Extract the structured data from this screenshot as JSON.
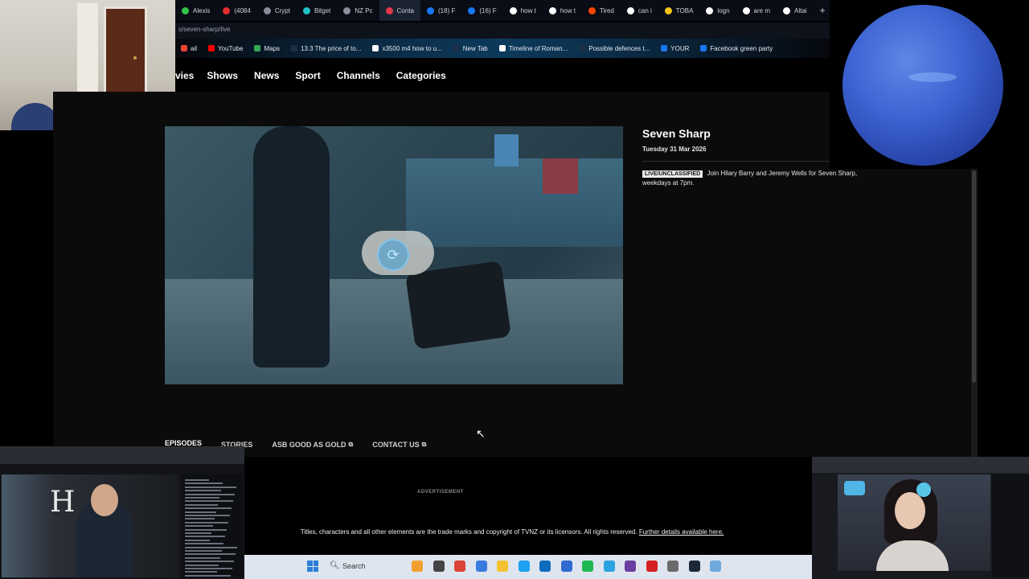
{
  "browser": {
    "tabs": [
      {
        "label": "Alexis",
        "color": "#33c24a"
      },
      {
        "label": "(4084",
        "color": "#e52e2e"
      },
      {
        "label": "Crypt",
        "color": "#8a8f9c"
      },
      {
        "label": "Bitget",
        "color": "#21c3c8"
      },
      {
        "label": "NZ Pc",
        "color": "#8a8f9c"
      },
      {
        "label": "Conta",
        "color": "#e0384a",
        "active": true
      },
      {
        "label": "(18) F",
        "color": "#1877f2"
      },
      {
        "label": "(16) F",
        "color": "#1877f2"
      },
      {
        "label": "how t",
        "color": "#ffffff"
      },
      {
        "label": "how t",
        "color": "#ffffff"
      },
      {
        "label": "Tired",
        "color": "#ff4500"
      },
      {
        "label": "can i",
        "color": "#ffffff"
      },
      {
        "label": "TOBA",
        "color": "#f5c518"
      },
      {
        "label": "logn",
        "color": "#ffffff"
      },
      {
        "label": "are m",
        "color": "#ffffff"
      },
      {
        "label": "Altai",
        "color": "#ffffff"
      }
    ],
    "new_tab": "+",
    "url": "s/seven-sharp/live",
    "bookmarks": [
      {
        "label": "ail",
        "color": "#ea4335"
      },
      {
        "label": "YouTube",
        "color": "#ff0000"
      },
      {
        "label": "Maps",
        "color": "#34a853"
      },
      {
        "label": "13.3 The price of to...",
        "color": "#1c2f45"
      },
      {
        "label": "x3500 m4 how to u...",
        "color": "#ffffff"
      },
      {
        "label": "New Tab",
        "color": "#1c2f45"
      },
      {
        "label": "Timeline of Roman...",
        "color": "#ffffff"
      },
      {
        "label": "Possible defences t...",
        "color": "#1c2f45"
      },
      {
        "label": "YOUR",
        "color": "#1877f2"
      },
      {
        "label": "Facebook green party",
        "color": "#1877f2"
      }
    ]
  },
  "site": {
    "nav": [
      "vies",
      "Shows",
      "News",
      "Sport",
      "Channels",
      "Categories"
    ]
  },
  "show": {
    "title": "Seven Sharp",
    "date": "Tuesday 31 Mar 2026",
    "badge": "LIVE/UNCLASSIFIED",
    "description": "Join Hilary Barry and Jeremy Wells for Seven Sharp, weekdays at 7pm."
  },
  "page_tabs": [
    {
      "label": "EPISODES",
      "active": true,
      "external": false
    },
    {
      "label": "STORIES",
      "active": false,
      "external": false
    },
    {
      "label": "ASB GOOD AS GOLD",
      "active": false,
      "external": true
    },
    {
      "label": "CONTACT US",
      "active": false,
      "external": true
    }
  ],
  "footer": {
    "ad_label": "ADVERTISEMENT",
    "copyright": "Titles, characters and all other elements are the trade marks and copyright of TVNZ or its licensors. All rights reserved.",
    "link": "Further details available here."
  },
  "taskbar": {
    "search_placeholder": "Search",
    "icons": [
      "widgets-icon",
      "task-view-icon",
      "chrome-icon",
      "photos-icon",
      "file-explorer-icon",
      "edge-icon",
      "outlook-icon",
      "store-icon",
      "spotify-icon",
      "telegram-icon",
      "obs-icon",
      "pdf-icon",
      "settings-icon",
      "steam-icon",
      "screenshot-icon"
    ],
    "icon_colors": [
      "#f0a030",
      "#444444",
      "#db4437",
      "#3a7be0",
      "#f3c232",
      "#1da1f2",
      "#0f6cbd",
      "#2f6ad0",
      "#1db954",
      "#2aa3e0",
      "#6b3fa0",
      "#d42020",
      "#6b6b6b",
      "#1b2838",
      "#6fa8dc"
    ]
  },
  "lower_left_overlay": {
    "logo_letter": "H"
  }
}
